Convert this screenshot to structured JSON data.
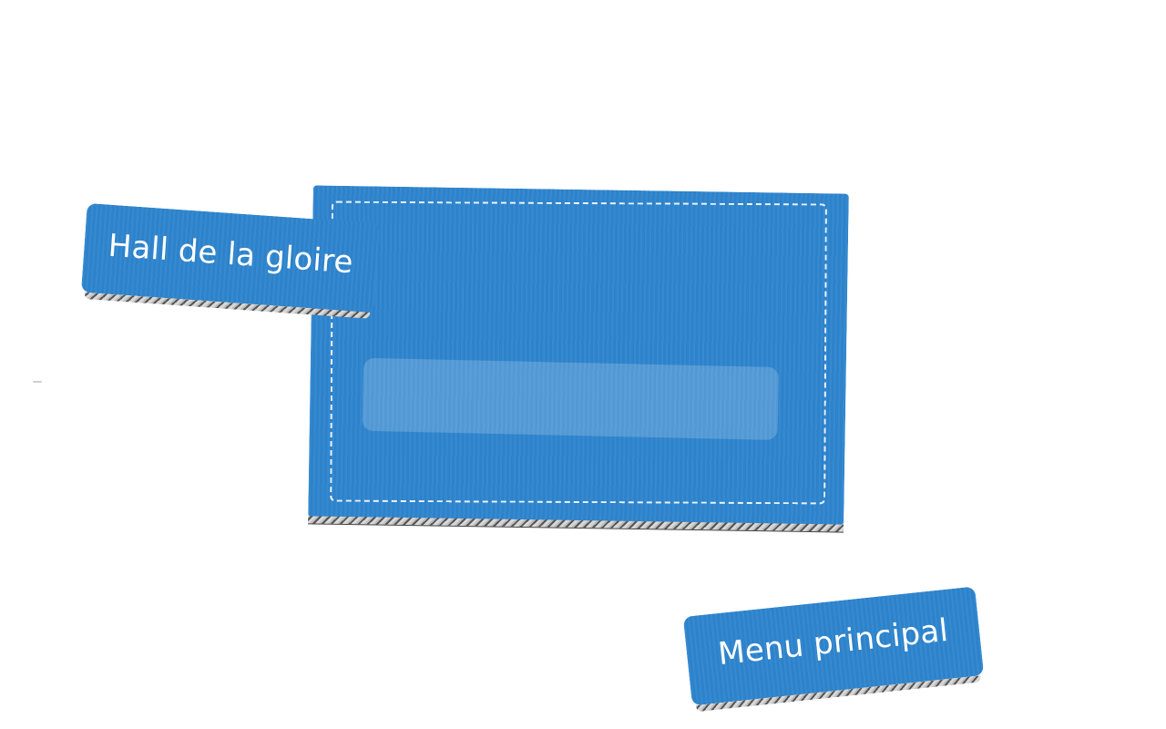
{
  "buttons": {
    "hall_of_fame": "Hall de la gloire",
    "main_menu": "Menu principal"
  },
  "panel": {
    "name_input_value": ""
  },
  "colors": {
    "cardboard_blue": "#2f86cf",
    "stitch": "#ffffff",
    "background": "#ffffff"
  }
}
